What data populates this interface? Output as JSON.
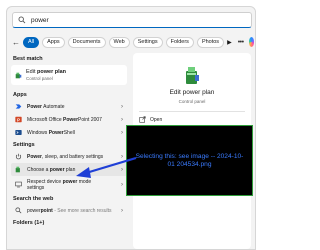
{
  "search": {
    "value": "power"
  },
  "filters": [
    "All",
    "Apps",
    "Documents",
    "Web",
    "Settings",
    "Folders",
    "Photos"
  ],
  "sections": {
    "best_match": "Best match",
    "apps": "Apps",
    "settings": "Settings",
    "search_web": "Search the web",
    "folders": "Folders (1+)"
  },
  "best_match": {
    "title_prefix": "Edit ",
    "title_bold": "power plan",
    "subtitle": "Control panel"
  },
  "apps": [
    {
      "prefix": "",
      "bold": "Power",
      "suffix": " Automate"
    },
    {
      "prefix": "Microsoft Office ",
      "bold": "Power",
      "suffix": "Point 2007"
    },
    {
      "prefix": "Windows ",
      "bold": "Power",
      "suffix": "Shell"
    }
  ],
  "settings": [
    {
      "prefix": "",
      "bold": "Power",
      "suffix": ", sleep, and battery settings"
    },
    {
      "prefix": "Choose a ",
      "bold": "power",
      "suffix": " plan"
    },
    {
      "prefix": "Respect device ",
      "bold": "power",
      "suffix": " mode",
      "line2": "settings"
    }
  ],
  "web": {
    "prefix": "power",
    "bold": "point",
    "suffix": " - See more search results"
  },
  "detail": {
    "title": "Edit power plan",
    "subtitle": "Control panel",
    "open_label": "Open"
  },
  "annotation": {
    "text": "Selecting this: see image -- 2024-10-01 204534.png"
  },
  "colors": {
    "accent": "#0067c0",
    "arrow": "#1f3fd6",
    "note_text": "#3a7bff",
    "note_border": "#2f9e3a"
  }
}
